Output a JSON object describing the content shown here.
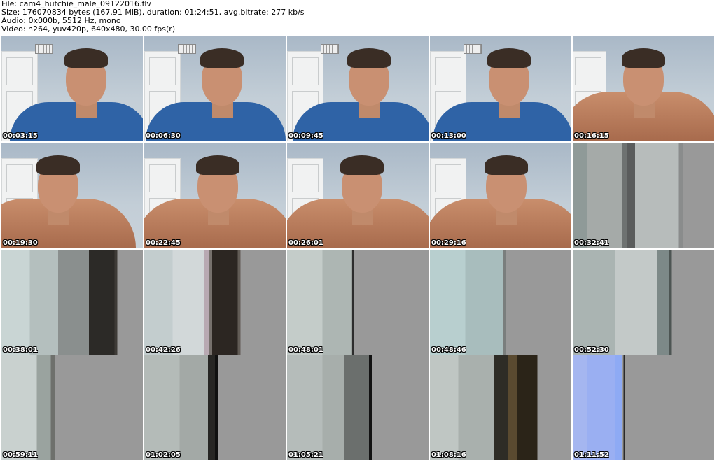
{
  "header": {
    "file": "File: cam4_hutchie_male_09122016.flv",
    "size": "Size: 176070834 bytes (167.91 MiB), duration: 01:24:51, avg.bitrate: 277 kb/s",
    "audio": "Audio: 0x000b, 5512 Hz, mono",
    "video": "Video: h264, yuv420p, 640x480, 30.00 fps(r)"
  },
  "thumbnails": [
    {
      "timestamp": "00:03:15",
      "scene": "shirt"
    },
    {
      "timestamp": "00:06:30",
      "scene": "shirt"
    },
    {
      "timestamp": "00:09:45",
      "scene": "shirt"
    },
    {
      "timestamp": "00:13:00",
      "scene": "shirt"
    },
    {
      "timestamp": "00:16:15",
      "scene": "bare"
    },
    {
      "timestamp": "00:19:30",
      "scene": "bare"
    },
    {
      "timestamp": "00:22:45",
      "scene": "bare"
    },
    {
      "timestamp": "00:26:01",
      "scene": "bare"
    },
    {
      "timestamp": "00:29:16",
      "scene": "bare"
    },
    {
      "timestamp": "00:32:41",
      "scene": "glitch"
    },
    {
      "timestamp": "00:38:01",
      "scene": "glitch"
    },
    {
      "timestamp": "00:42:26",
      "scene": "glitch"
    },
    {
      "timestamp": "00:48:01",
      "scene": "glitch"
    },
    {
      "timestamp": "00:48:46",
      "scene": "glitch"
    },
    {
      "timestamp": "00:52:30",
      "scene": "glitch"
    },
    {
      "timestamp": "00:59:11",
      "scene": "glitch"
    },
    {
      "timestamp": "01:02:05",
      "scene": "glitch"
    },
    {
      "timestamp": "01:05:21",
      "scene": "glitch"
    },
    {
      "timestamp": "01:08:16",
      "scene": "glitch"
    },
    {
      "timestamp": "01:11:52",
      "scene": "glitch-blue"
    }
  ]
}
